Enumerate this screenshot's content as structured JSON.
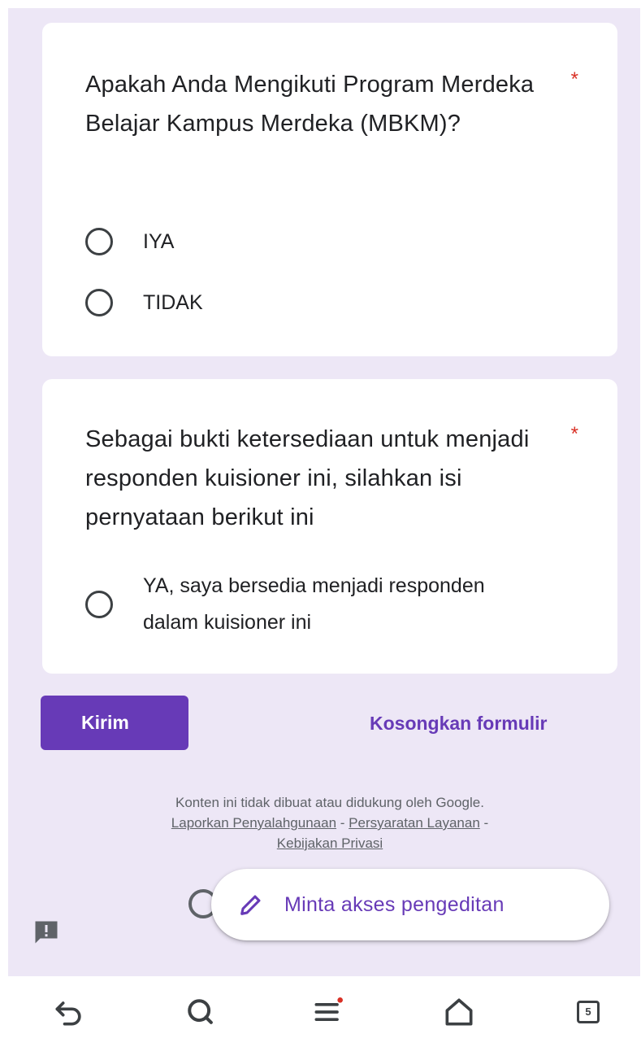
{
  "form": {
    "questions": [
      {
        "text": "Apakah Anda Mengikuti Program Merdeka Belajar Kampus Merdeka (MBKM)?",
        "required_mark": "*",
        "options": [
          "IYA",
          "TIDAK"
        ]
      },
      {
        "text": "Sebagai bukti ketersediaan untuk menjadi responden kuisioner ini, silahkan isi pernyataan berikut ini",
        "required_mark": "*",
        "options": [
          "YA, saya bersedia menjadi responden dalam kuisioner ini"
        ]
      }
    ],
    "submit_label": "Kirim",
    "clear_label": "Kosongkan formulir"
  },
  "footer": {
    "disclaimer": "Konten ini tidak dibuat atau didukung oleh Google.",
    "report_abuse": "Laporkan Penyalahgunaan",
    "separator": "-",
    "terms": "Persyaratan Layanan",
    "privacy": "Kebijakan Privasi"
  },
  "fab": {
    "label": "Minta akses pengeditan",
    "icon": "pencil-icon"
  },
  "browser_nav": {
    "tab_count": "5",
    "icons": [
      "back-icon",
      "search-icon",
      "menu-icon",
      "home-icon",
      "tabs-icon"
    ],
    "notification_dot_color": "#d93025"
  },
  "colors": {
    "accent": "#673ab7",
    "background": "#ede7f6",
    "required": "#d93025"
  }
}
